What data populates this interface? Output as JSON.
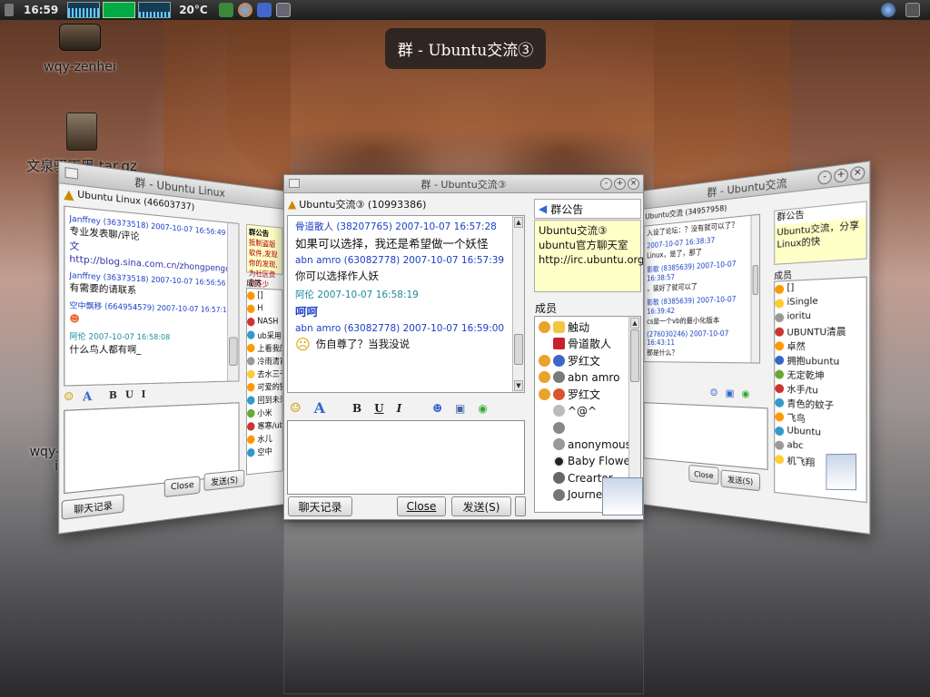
{
  "topbar": {
    "clock": "16:59",
    "temperature": "20°C"
  },
  "osd_title": "群 - Ubuntu交流③",
  "desktop_icons": [
    {
      "label": "wqy-zenhei"
    },
    {
      "label": "文泉驿正黑.tar.gz"
    },
    {
      "label": "wqy-z"
    },
    {
      "label": "i5-"
    }
  ],
  "main_window": {
    "title": "群 - Ubuntu交流③",
    "group_header": "Ubuntu交流③ (10993386)",
    "messages": [
      {
        "header": "骨道散人 (38207765) 2007-10-07 16:57:28",
        "body": "如果可以选择，我还是希望做一个妖怪"
      },
      {
        "header": "abn amro (63082778) 2007-10-07 16:57:39",
        "body": "你可以选择作人妖"
      },
      {
        "header": "阿伦 2007-10-07 16:58:19",
        "body": "呵呵"
      },
      {
        "header": "abn amro (63082778) 2007-10-07 16:59:00",
        "body": "伤自尊了？当我没说"
      }
    ],
    "toolbar": {
      "bold": "B",
      "underline": "U",
      "italic": "I",
      "font": "A"
    },
    "buttons": {
      "history": "聊天记录",
      "close": "Close",
      "send": "发送(S)"
    },
    "notice_label": "群公告",
    "notice_text": "Ubuntu交流③ ubuntu官方聊天室 http://irc.ubuntu.org",
    "members_label": "成员",
    "members": [
      "触动",
      "骨道散人",
      "罗红文",
      "abn amro",
      "罗红文",
      "^@^",
      "",
      "anonymous",
      "Baby Flower",
      "Creartor",
      "Journe"
    ]
  },
  "left_window": {
    "title": "群 - Ubuntu Linux",
    "group_header": "Ubuntu Linux (46603737)",
    "messages": [
      {
        "header": "Janffrey (36373518) 2007-10-07 16:56:49",
        "body": "专业发表聊/评论"
      },
      {
        "header": "",
        "body": "文http://blog.sina.com.cn/zhongpengqishi"
      },
      {
        "header": "Janffrey (36373518) 2007-10-07 16:56:56",
        "body": "有需要的请联系"
      },
      {
        "header": "空中飘移 (664954579) 2007-10-07 16:57:14",
        "body": ""
      },
      {
        "header": "阿伦 2007-10-07 16:58:08",
        "body": "什么鸟人都有啊_"
      }
    ],
    "notice_label": "群公告",
    "notice_text": "抵制盗版软件,发现你的发现,为社区贡献不少",
    "members_label": "成员",
    "members": [
      "[]",
      "H",
      "NASH",
      "ub采用",
      "上看我的",
      "冷雨清宵",
      "去水三千",
      "可爱的猪",
      "回到未来",
      "小米",
      "寒寒/ubu",
      "水儿",
      "空中"
    ],
    "buttons": {
      "history": "聊天记录",
      "close": "Close",
      "send": "发送(S)"
    }
  },
  "right_window": {
    "title": "群 - Ubuntu交流",
    "group_header": "Ubuntu交流 (34957958)",
    "messages": [
      {
        "header": "",
        "body": "入设了论坛：？没有就可以了？"
      },
      {
        "header": "2007-10-07 16:38:37",
        "body": ""
      },
      {
        "header": "",
        "body": "Linux，是了，那了"
      },
      {
        "header": "影歌 (8385639) 2007-10-07 16:38:57",
        "body": "，装好了就可以了"
      },
      {
        "header": "影歌 (8385639) 2007-10-07 16:39:42",
        "body": "cs是一个vb的最小化版本"
      },
      {
        "header": "(276030246) 2007-10-07 16:43:11",
        "body": "那是什么？"
      }
    ],
    "notice_label": "群公告",
    "notice_text": "Ubuntu交流，分享Linux的快",
    "members_label": "成员",
    "members": [
      "[]",
      "iSingle",
      "ioritu",
      "UBUNTU清晨",
      "卓然",
      "拥抱ubuntu",
      "无定乾坤",
      "水手/tu",
      "青色的蚊子",
      "飞鸟",
      "Ubuntu",
      "abc",
      "机飞翔"
    ],
    "buttons": {
      "close": "Close",
      "send": "发送(S)"
    }
  },
  "colors": {
    "accent_blue": "#1a3fc6",
    "notice_bg": "#ffffc8",
    "teal": "#1d8a9a"
  }
}
